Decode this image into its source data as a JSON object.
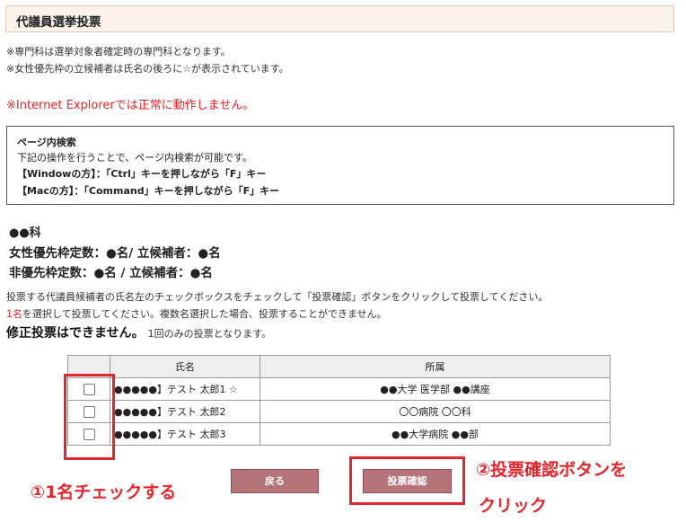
{
  "header": {
    "title": "代議員選挙投票"
  },
  "notes": [
    "※専門科は選挙対象者確定時の専門科となります。",
    "※女性優先枠の立候補者は氏名の後ろに☆が表示されています。"
  ],
  "warning": "※Internet Explorerでは正常に動作しません。",
  "page_search": {
    "title": "ページ内検索",
    "description": "下記の操作を行うことで、ページ内検索が可能です。",
    "windows_label": "【Windowの方】：",
    "windows_text": "「Ctrl」キーを押しながら「F」キー",
    "mac_label": "【Macの方】：",
    "mac_text": "「Command」キーを押しながら「F」キー"
  },
  "department": "●●科",
  "counts": {
    "female": "女性優先枠定数：●名/ 立候補者：●名",
    "general": "非優先枠定数：●名 / 立候補者：●名"
  },
  "instructions": {
    "line1": "投票する代議員候補者の氏名左のチェックボックスをチェックして「投票確認」ボタンをクリックして投票してください。",
    "line2_red": "1名",
    "line2_rest": "を選択して投票してください。複数名選択した場合、投票することができません。",
    "no_fix": "修正投票はできません。",
    "once": "1回のみの投票となります。"
  },
  "table": {
    "headers": [
      "",
      "氏名",
      "所属"
    ],
    "rows": [
      {
        "name": "●●●●●】テスト 太郎1 ☆",
        "affiliation": "●●大学 医学部 ●●講座",
        "checked": false
      },
      {
        "name": "●●●●●】テスト 太郎2",
        "affiliation": "〇〇病院 〇〇科",
        "checked": false
      },
      {
        "name": "●●●●●】テスト 太郎3",
        "affiliation": "●●大学病院 ●●部",
        "checked": false
      }
    ]
  },
  "buttons": {
    "back": "戻る",
    "confirm": "投票確認"
  },
  "annotations": {
    "check_one": "①1名チェックする",
    "click_confirm_1": "②投票確認ボタンを",
    "click_confirm_2": "クリック"
  },
  "colors": {
    "accent_red": "#e3262b",
    "button": "#b5737a",
    "title_bg": "#fbf2ea"
  }
}
